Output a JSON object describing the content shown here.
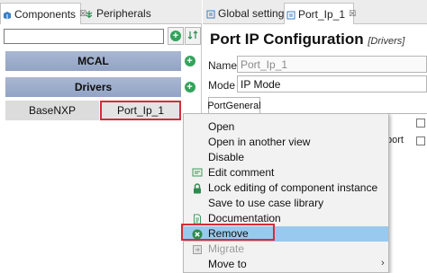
{
  "left_tabs": [
    {
      "label": "Components",
      "close": "☒"
    },
    {
      "label": "Peripherals"
    }
  ],
  "filter": {
    "value": "",
    "placeholder": ""
  },
  "categories": [
    {
      "label": "MCAL"
    },
    {
      "label": "Drivers"
    }
  ],
  "components": [
    {
      "label": "BaseNXP"
    },
    {
      "label": "Port_Ip_1"
    }
  ],
  "right_tabs": [
    {
      "label": "Global settings"
    },
    {
      "label": "Port_Ip_1",
      "close": "☒"
    }
  ],
  "config": {
    "title": "Port IP Configuration",
    "subtitle": "[Drivers]",
    "name_label": "Name",
    "name_value": "Port_Ip_1",
    "mode_label": "Mode",
    "mode_value": "IP Mode",
    "tab_label": "PortGeneral",
    "partial_text": "port"
  },
  "context_menu": {
    "items": [
      {
        "label": "Open",
        "icon": "none"
      },
      {
        "label": "Open in another view",
        "icon": "none"
      },
      {
        "label": "Disable",
        "icon": "none"
      },
      {
        "label": "Edit comment",
        "icon": "comment-icon"
      },
      {
        "label": "Lock editing of component instance",
        "icon": "lock-icon"
      },
      {
        "label": "Save to use case library",
        "icon": "none"
      },
      {
        "label": "Documentation",
        "icon": "documentation-icon"
      },
      {
        "label": "Remove",
        "icon": "remove-icon"
      },
      {
        "label": "Migrate",
        "icon": "migrate-icon",
        "disabled": true
      },
      {
        "label": "Move to",
        "icon": "none",
        "submenu": "›"
      }
    ]
  },
  "colors": {
    "accent_green": "#33a35b",
    "category_bar": "#a3b2cf",
    "highlight_outline": "#d42d3a",
    "menu_selection": "#99c9ee"
  }
}
